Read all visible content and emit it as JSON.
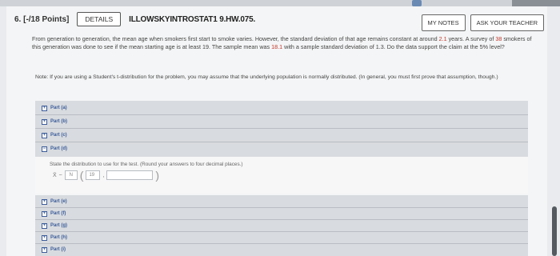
{
  "question": {
    "number": "6. [-/18 Points]",
    "details_label": "DETAILS",
    "assignment_id": "ILLOWSKYINTROSTAT1 9.HW.075.",
    "my_notes_label": "MY NOTES",
    "ask_teacher_label": "ASK YOUR TEACHER"
  },
  "problem": {
    "t1": "From generation to generation, the mean age when smokers first start to smoke varies. However, the standard deviation of that age remains constant at around ",
    "sd": "2.1",
    "t2": " years. A survey of ",
    "n": "38",
    "t3": " smokers of this generation was done to see if the mean starting age is at least 19. The sample mean was ",
    "mean": "18.1",
    "t4": " with a sample standard deviation of 1.3. Do the data support the claim at the 5% level?"
  },
  "note": "Note: If you are using a Student's t-distribution for the problem, you may assume that the underlying population is normally distributed. (In general, you must first prove that assumption, though.)",
  "parts_collapsed_top": [
    {
      "label": "Part (a)",
      "symbol": "+"
    },
    {
      "label": "Part (b)",
      "symbol": "+"
    },
    {
      "label": "Part (c)",
      "symbol": "+"
    }
  ],
  "part_d": {
    "label": "Part (d)",
    "symbol": "−",
    "instruction": "State the distribution to use for the test. (Round your answers to four decimal places.)",
    "var_label": "X̄",
    "tilde": "~",
    "dist_select": "N",
    "mean_value": "19",
    "sd_value": ""
  },
  "parts_collapsed_bottom": [
    {
      "label": "Part (e)",
      "symbol": "+"
    },
    {
      "label": "Part (f)",
      "symbol": "+"
    },
    {
      "label": "Part (g)",
      "symbol": "+"
    },
    {
      "label": "Part (h)",
      "symbol": "+"
    },
    {
      "label": "Part (i)",
      "symbol": "+"
    }
  ],
  "colors": {
    "highlight": "#c0392b",
    "part_link": "#3b5c9a"
  }
}
